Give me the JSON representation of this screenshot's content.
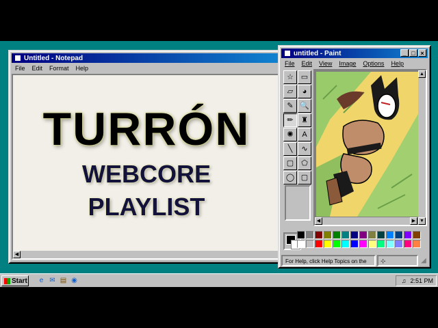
{
  "notepad": {
    "title": "Untitled - Notepad",
    "menu": [
      "File",
      "Edit",
      "Format",
      "Help"
    ],
    "text_line1": "TURRÓN",
    "text_line2": "WEBCORE",
    "text_line3": "PLAYLIST"
  },
  "paint": {
    "title": "untitled - Paint",
    "menu": [
      "File",
      "Edit",
      "View",
      "Image",
      "Options",
      "Help"
    ],
    "status": "For Help, click Help Topics on the",
    "tools": [
      "free-select-icon",
      "rect-select-icon",
      "eraser-icon",
      "fill-icon",
      "picker-icon",
      "magnifier-icon",
      "pencil-icon",
      "brush-icon",
      "airbrush-icon",
      "text-icon",
      "line-icon",
      "curve-icon",
      "rectangle-icon",
      "polygon-icon",
      "ellipse-icon",
      "rounded-rect-icon"
    ],
    "tool_glyphs": [
      "☆",
      "▭",
      "▱",
      "◕",
      "✎",
      "🔍",
      "✏",
      "♜",
      "✺",
      "A",
      "╲",
      "∿",
      "▢",
      "⬠",
      "◯",
      "▢"
    ],
    "palette": [
      "#000000",
      "#808080",
      "#800000",
      "#808000",
      "#008000",
      "#008080",
      "#000080",
      "#800080",
      "#808040",
      "#004040",
      "#0080ff",
      "#004080",
      "#8000ff",
      "#804000",
      "#ffffff",
      "#c0c0c0",
      "#ff0000",
      "#ffff00",
      "#00ff00",
      "#00ffff",
      "#0000ff",
      "#ff00ff",
      "#ffff80",
      "#00ff80",
      "#80ffff",
      "#8080ff",
      "#ff0080",
      "#ff8040"
    ]
  },
  "taskbar": {
    "start_label": "Start",
    "time": "2:51 PM"
  }
}
